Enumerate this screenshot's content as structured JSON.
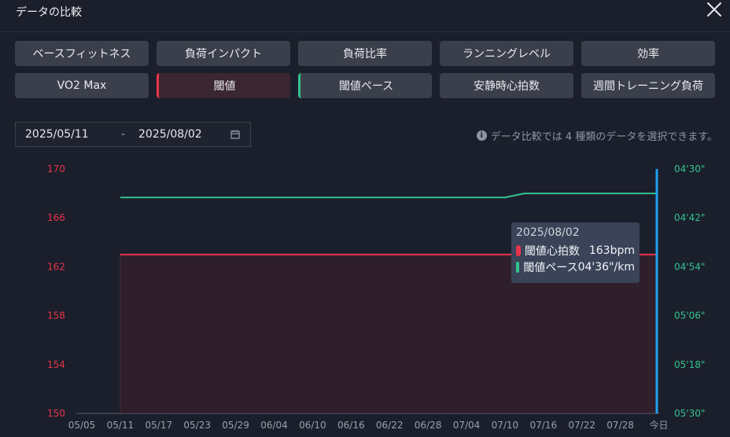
{
  "title": "データの比較",
  "metrics": [
    {
      "label": "ベースフィットネス",
      "state": "normal"
    },
    {
      "label": "負荷インパクト",
      "state": "normal"
    },
    {
      "label": "負荷比率",
      "state": "normal"
    },
    {
      "label": "ランニングレベル",
      "state": "normal"
    },
    {
      "label": "効率",
      "state": "normal"
    },
    {
      "label": "VO2 Max",
      "state": "normal"
    },
    {
      "label": "閾値",
      "state": "selected-red"
    },
    {
      "label": "閾値ペース",
      "state": "selected-green"
    },
    {
      "label": "安静時心拍数",
      "state": "normal"
    },
    {
      "label": "週間トレーニング負荷",
      "state": "normal"
    }
  ],
  "date_range": {
    "start": "2025/05/11",
    "separator": "-",
    "end": "2025/08/02"
  },
  "info_text": "データ比較では 4 種類のデータを選択できます。",
  "tooltip": {
    "date": "2025/08/02",
    "rows": [
      {
        "label": "閾値心拍数",
        "value": "163bpm",
        "color": "#e8344b"
      },
      {
        "label": "閾値ペース",
        "value": "04'36\"/km",
        "color": "#34c28f"
      }
    ]
  },
  "chart_data": {
    "type": "line",
    "x_ticks": [
      "05/05",
      "05/11",
      "05/17",
      "05/23",
      "05/29",
      "06/04",
      "06/10",
      "06/16",
      "06/22",
      "06/28",
      "07/04",
      "07/10",
      "07/16",
      "07/22",
      "07/28",
      "今日"
    ],
    "left_axis": {
      "ticks": [
        "170",
        "166",
        "162",
        "158",
        "154",
        "150"
      ],
      "range": [
        150,
        170
      ],
      "color": "#e8344b"
    },
    "right_axis": {
      "ticks": [
        "04'30\"",
        "04'42\"",
        "04'54\"",
        "05'06\"",
        "05'18\"",
        "05'30\""
      ],
      "range_seconds": [
        270,
        330
      ],
      "color": "#34c28f"
    },
    "series": [
      {
        "name": "閾値心拍数",
        "axis": "left",
        "color": "#e8344b",
        "fill": true,
        "points": [
          {
            "x": "05/11",
            "y": 163
          },
          {
            "x": "今日",
            "y": 163
          }
        ]
      },
      {
        "name": "閾値ペース",
        "axis": "right",
        "color": "#34c28f",
        "points": [
          {
            "x": "05/11",
            "y": 277
          },
          {
            "x": "07/10",
            "y": 277
          },
          {
            "x": "07/13",
            "y": 276
          },
          {
            "x": "今日",
            "y": 276
          }
        ]
      }
    ],
    "cursor": {
      "x": "今日",
      "color": "#1fa2f2"
    }
  }
}
